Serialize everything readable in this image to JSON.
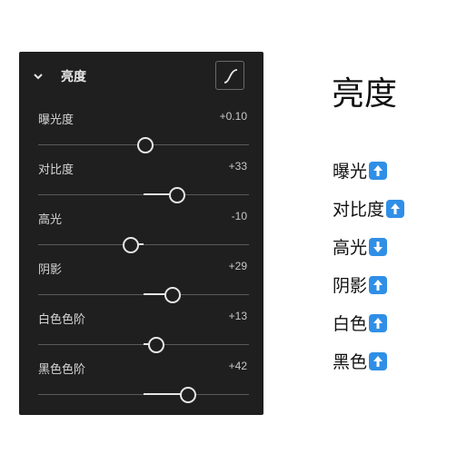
{
  "panel": {
    "title": "亮度",
    "sliders": [
      {
        "label": "曝光度",
        "value": "+0.10",
        "level": 0.51
      },
      {
        "label": "对比度",
        "value": "+33",
        "level": 0.66
      },
      {
        "label": "高光",
        "value": "-10",
        "level": 0.44
      },
      {
        "label": "阴影",
        "value": "+29",
        "level": 0.64
      },
      {
        "label": "白色色阶",
        "value": "+13",
        "level": 0.56
      },
      {
        "label": "黑色色阶",
        "value": "+42",
        "level": 0.71
      }
    ]
  },
  "notes": {
    "title": "亮度",
    "items": [
      {
        "label": "曝光",
        "direction": "up"
      },
      {
        "label": "对比度",
        "direction": "up"
      },
      {
        "label": "高光",
        "direction": "down"
      },
      {
        "label": "阴影",
        "direction": "up"
      },
      {
        "label": "白色",
        "direction": "up"
      },
      {
        "label": "黑色",
        "direction": "up"
      }
    ]
  },
  "colors": {
    "panel_bg": "#1f1f1f",
    "accent": "#2f8fe6"
  },
  "icons": {
    "collapse": "chevron-down-icon",
    "curve": "tone-curve-icon",
    "up": "arrow-up-icon",
    "down": "arrow-down-icon"
  }
}
